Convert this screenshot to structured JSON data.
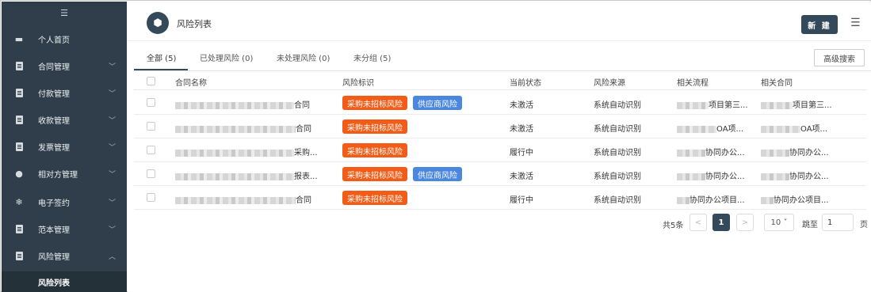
{
  "sidebar": {
    "items": [
      {
        "label": "个人首页",
        "icon": "monitor-icon",
        "chevron": ""
      },
      {
        "label": "合同管理",
        "icon": "document-icon",
        "chevron": "﹀"
      },
      {
        "label": "付款管理",
        "icon": "document-icon",
        "chevron": "﹀"
      },
      {
        "label": "收款管理",
        "icon": "document-icon",
        "chevron": "﹀"
      },
      {
        "label": "发票管理",
        "icon": "document-icon",
        "chevron": "﹀"
      },
      {
        "label": "相对方管理",
        "icon": "person-icon",
        "chevron": "﹀"
      },
      {
        "label": "电子签约",
        "icon": "snowflake-icon",
        "chevron": "﹀"
      },
      {
        "label": "范本管理",
        "icon": "document-icon",
        "chevron": "﹀"
      },
      {
        "label": "风险管理",
        "icon": "document-icon",
        "chevron": "︿"
      }
    ],
    "active_sub": "风险列表"
  },
  "header": {
    "title": "风险列表",
    "new_button": "新 建"
  },
  "tabs": [
    {
      "label": "全部 (5)",
      "active": true
    },
    {
      "label": "已处理风险 (0)",
      "active": false
    },
    {
      "label": "未处理风险 (0)",
      "active": false
    },
    {
      "label": "未分组 (5)",
      "active": false
    }
  ],
  "advanced_search": "高级搜索",
  "table": {
    "columns": [
      "合同名称",
      "风险标识",
      "当前状态",
      "风险来源",
      "相关流程",
      "相关合同"
    ],
    "rows": [
      {
        "name_suffix": "合同",
        "tags": [
          "采购未招标风险",
          "供应商风险"
        ],
        "status": "未激活",
        "source": "系统自动识别",
        "flow": "项目第三...",
        "contract": "项目第三..."
      },
      {
        "name_suffix": "合同",
        "tags": [
          "采购未招标风险"
        ],
        "status": "未激活",
        "source": "系统自动识别",
        "flow": "OA项...",
        "contract": "OA项..."
      },
      {
        "name_suffix": "采购...",
        "tags": [
          "采购未招标风险"
        ],
        "status": "履行中",
        "source": "系统自动识别",
        "flow": "协同办公...",
        "contract": "协同办公..."
      },
      {
        "name_suffix": "报表...",
        "tags": [
          "采购未招标风险",
          "供应商风险"
        ],
        "status": "未激活",
        "source": "系统自动识别",
        "flow": "协同办公...",
        "contract": "协同办公..."
      },
      {
        "name_suffix": "合同",
        "tags": [
          "采购未招标风险"
        ],
        "status": "履行中",
        "source": "系统自动识别",
        "flow": "协同办公项目...",
        "contract": "协同办公项目..."
      }
    ]
  },
  "pagination": {
    "total": "共5条",
    "prev": "<",
    "current": "1",
    "next": ">",
    "page_size": "10 ˅",
    "jump_label": "跳至",
    "jump_value": "1",
    "page_suffix": "页"
  },
  "colors": {
    "sidebar_bg": "#2f3e4a",
    "accent": "#34495a",
    "tag_orange": "#f25c16",
    "tag_blue": "#4a87de"
  }
}
